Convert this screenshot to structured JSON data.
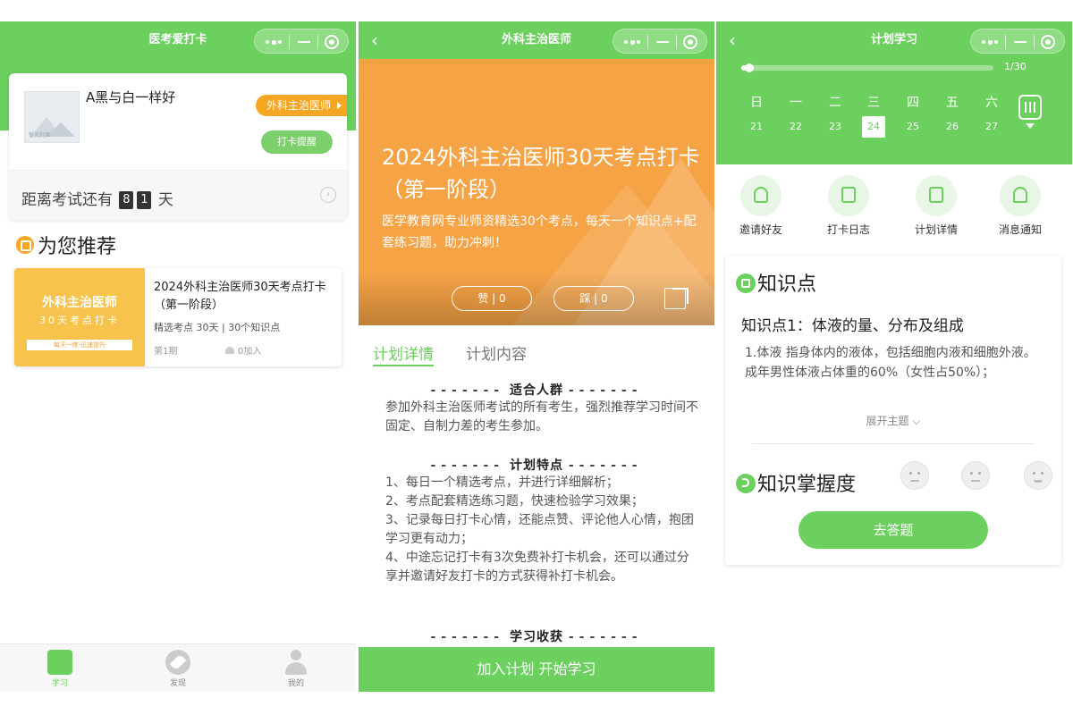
{
  "screen1": {
    "title": "医考爱打卡",
    "user_name": "A黑与白一样好",
    "thumb_text": "暂无封面",
    "tag": "外科主治医师",
    "remind_btn": "打卡提醒",
    "countdown_prefix": "距离考试还有",
    "countdown_d1": "8",
    "countdown_d2": "1",
    "countdown_suffix": "天",
    "rec_title": "为您推荐",
    "rec": {
      "cover_title": "外科主治医师",
      "cover_sub": "30天考点打卡",
      "cover_band": "每天一练·迅速提升",
      "name": "2024外科主治医师30天考点打卡（第一阶段）",
      "meta": "精选考点  30天 | 30个知识点",
      "period": "第1期",
      "joined": "0加入"
    },
    "tabs": [
      "学习",
      "发现",
      "我的"
    ]
  },
  "screen2": {
    "title": "外科主治医师",
    "hero_title": "2024外科主治医师30天考点打卡（第一阶段）",
    "hero_desc": "医学教育网专业师资精选30个考点，每天一个知识点+配套练习题，助力冲刺！",
    "like": "赞 | 0",
    "dislike": "踩 | 0",
    "tab_detail": "计划详情",
    "tab_content": "计划内容",
    "sec1_title": "适合人群",
    "sec1_text": "参加外科主治医师考试的所有考生，强烈推荐学习时间不固定、自制力差的考生参加。",
    "sec2_title": "计划特点",
    "sec2_items": [
      "1、每日一个精选考点，并进行详细解析；",
      "2、考点配套精选练习题，快速检验学习效果；",
      "3、记录每日打卡心情，还能点赞、评论他人心情，抱团学习更有动力；",
      "4、中途忘记打卡有3次免费补打卡机会，还可以通过分享并邀请好友打卡的方式获得补打卡机会。"
    ],
    "sec3_title": "学习收获",
    "dash": "-------",
    "bottom_btn": "加入计划 开始学习"
  },
  "screen3": {
    "title": "计划学习",
    "progress_text": "1/30",
    "progress_value": 0.0333,
    "weekdays": [
      "日",
      "一",
      "二",
      "三",
      "四",
      "五",
      "六"
    ],
    "dates": [
      "21",
      "22",
      "23",
      "24",
      "25",
      "26",
      "27"
    ],
    "today_index": 3,
    "quick": [
      "邀请好友",
      "打卡日志",
      "计划详情",
      "消息通知"
    ],
    "k_title": "知识点",
    "k_sub": "知识点1：体液的量、分布及组成",
    "k_body1": "1.体液   指身体内的液体，包括细胞内液和细胞外液。",
    "k_body2": "成年男性体液占体重的60%（女性占50%）；",
    "k_expand": "展开主题",
    "m_title": "知识掌握度",
    "go_btn": "去答题"
  },
  "colors": {
    "green": "#6bd05d",
    "orange": "#f6a346",
    "tag_orange": "#f5a623"
  }
}
